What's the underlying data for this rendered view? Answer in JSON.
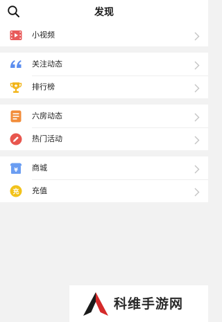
{
  "header": {
    "title": "发现"
  },
  "groups": [
    {
      "items": [
        {
          "label": "小视频",
          "icon": "video-icon",
          "color": "#e85a5a"
        }
      ]
    },
    {
      "items": [
        {
          "label": "关注动态",
          "icon": "quote-icon",
          "color": "#5b8def"
        },
        {
          "label": "排行榜",
          "icon": "trophy-icon",
          "color": "#f2b51a"
        }
      ]
    },
    {
      "items": [
        {
          "label": "六房动态",
          "icon": "list-icon",
          "color": "#f28c3a"
        },
        {
          "label": "热门活动",
          "icon": "pencil-icon",
          "color": "#e8564e"
        }
      ]
    },
    {
      "items": [
        {
          "label": "商城",
          "icon": "shop-icon",
          "color": "#6a9df2"
        },
        {
          "label": "充值",
          "icon": "coin-icon",
          "color": "#f2c21a"
        }
      ]
    }
  ],
  "watermark": {
    "text": "科维手游网"
  }
}
